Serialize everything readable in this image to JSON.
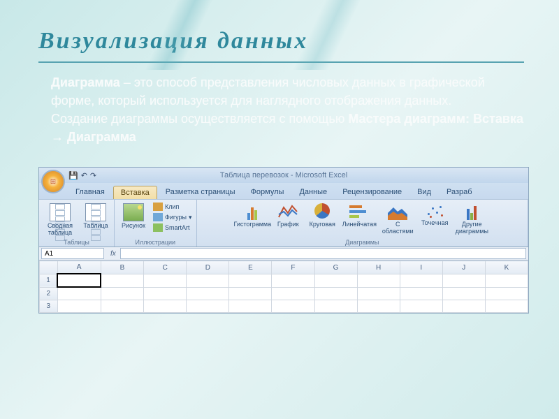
{
  "slide": {
    "title": "Визуализация данных",
    "paragraph1_lead": "Диаграмма",
    "paragraph1_rest": " – это способ представления числовых данных в графической форме, который используется для наглядного отображения данных.",
    "paragraph2_a": "Создание диаграммы осуществляется с помощью ",
    "paragraph2_b": "Мастера диаграмм: Вставка → Диаграмма"
  },
  "excel": {
    "window_title": "Таблица перевозок - Microsoft Excel",
    "qat": {
      "save": "💾",
      "undo": "↶",
      "redo": "↷"
    },
    "tabs": [
      "Главная",
      "Вставка",
      "Разметка страницы",
      "Формулы",
      "Данные",
      "Рецензирование",
      "Вид",
      "Разраб"
    ],
    "active_tab_index": 1,
    "groups": {
      "tables": {
        "label": "Таблицы",
        "pivot": "Сводная таблица",
        "table": "Таблица"
      },
      "illustrations": {
        "label": "Иллюстрации",
        "picture": "Рисунок",
        "clip": "Клип",
        "shapes": "Фигуры",
        "smartart": "SmartArt"
      },
      "charts": {
        "label": "Диаграммы",
        "column": "Гистограмма",
        "line": "График",
        "pie": "Круговая",
        "bar": "Линейчатая",
        "area": "С областями",
        "scatter": "Точечная",
        "other": "Другие диаграммы"
      }
    },
    "name_box": "A1",
    "fx_label": "fx",
    "columns": [
      "A",
      "B",
      "C",
      "D",
      "E",
      "F",
      "G",
      "H",
      "I",
      "J",
      "K"
    ],
    "rows": [
      "1",
      "2",
      "3"
    ]
  }
}
